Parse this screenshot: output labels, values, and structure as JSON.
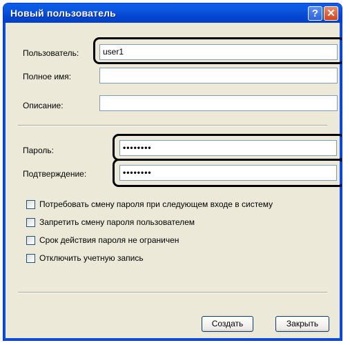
{
  "window": {
    "title": "Новый пользователь",
    "help_glyph": "?",
    "close_glyph": "✕"
  },
  "form": {
    "username_label": "Пользователь:",
    "username_value": "user1",
    "fullname_label": "Полное имя:",
    "fullname_value": "",
    "description_label": "Описание:",
    "description_value": "",
    "password_label": "Пароль:",
    "password_value": "••••••••",
    "confirm_label": "Подтверждение:",
    "confirm_value": "••••••••"
  },
  "options": [
    {
      "label": "Потребовать смену пароля при следующем входе в систему",
      "checked": false
    },
    {
      "label": "Запретить смену пароля пользователем",
      "checked": false
    },
    {
      "label": "Срок действия пароля не ограничен",
      "checked": false
    },
    {
      "label": "Отключить учетную запись",
      "checked": false
    }
  ],
  "buttons": {
    "create": "Создать",
    "close": "Закрыть"
  },
  "colors": {
    "titlebar": "#0545cf",
    "dialog_bg": "#ece9d8",
    "highlight_ring": "#000000"
  }
}
